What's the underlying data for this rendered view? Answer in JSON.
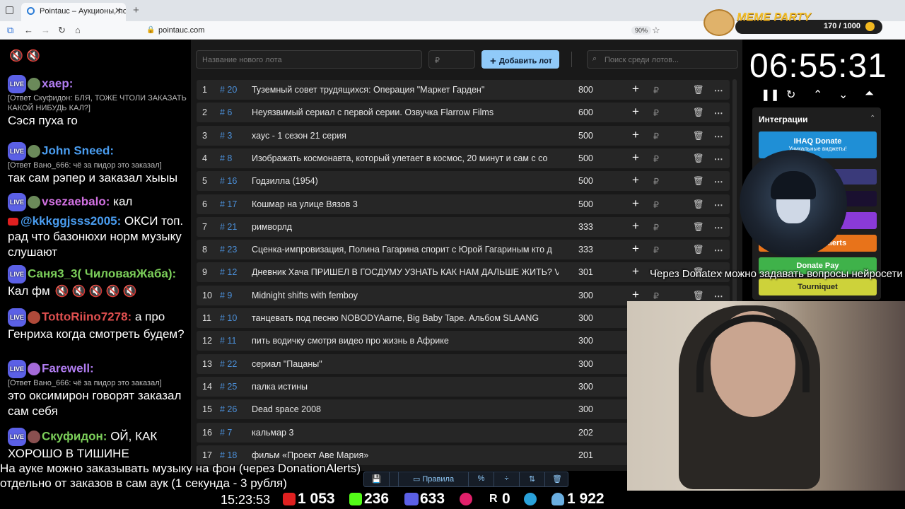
{
  "browser": {
    "tab_title": "Pointauc – Аукционы, лотереи",
    "url": "pointauc.com",
    "zoom": "90%"
  },
  "chat": [
    {
      "type": "emotes",
      "text": "🔇 🔇"
    },
    {
      "user": "хаер:",
      "user_color": "#b07cf0",
      "reply": "[Ответ Скуфидон: БЛЯ, ТОЖЕ ЧТОЛИ ЗАКАЗАТЬ КАКОЙ НИБУДЬ КАЛ?]",
      "msg": "Сэся пуха го"
    },
    {
      "user": "John Sneed:",
      "user_color": "#4a9df0",
      "reply": "[Ответ Вано_666: чё за пидор это заказал]",
      "msg": "так сам рэпер и заказал хыыы"
    },
    {
      "user": "vsezaebalo:",
      "user_color": "#d070e0",
      "msg": "кал"
    },
    {
      "user": "@kkkggjsss2005:",
      "user_color": "#4a9df0",
      "msg": "ОКСИ топ. рад что базонюхи норм музыку слушают"
    },
    {
      "user": "Саня3_3( ЧиловаяЖаба):",
      "user_color": "#7ccf5a",
      "msg": "Кал фм"
    },
    {
      "user": "TottoRiino7278:",
      "user_color": "#e05050",
      "msg": "а про Генриха когда смотреть будем?"
    },
    {
      "user": "Farewell:",
      "user_color": "#b07cf0",
      "reply": "[Ответ Вано_666: чё за пидор это заказал]",
      "msg": "это оксимирон говорят заказал сам себя"
    },
    {
      "user": "Скуфидон:",
      "user_color": "#7ccf5a",
      "msg": "ОЙ, КАК ХОРОШО В ТИШИНЕ"
    }
  ],
  "lot_input_placeholder": "Название нового лота",
  "amount_placeholder": "₽",
  "add_button": "Добавить лот",
  "search_placeholder": "Поиск среди лотов...",
  "lots": [
    {
      "n": "1",
      "id": "# 20",
      "title": "Туземный совет трудящихся: Операция \"Маркет Гарден\"",
      "amount": "800"
    },
    {
      "n": "2",
      "id": "# 6",
      "title": "Неуязвимый сериал с первой серии. Озвучка Flarrow Films",
      "amount": "600"
    },
    {
      "n": "3",
      "id": "# 3",
      "title": "хаус - 1 сезон 21 серия",
      "amount": "500"
    },
    {
      "n": "4",
      "id": "# 8",
      "title": "Изображать космонавта, который улетает в космос, 20 минут и сам с со",
      "amount": "500"
    },
    {
      "n": "5",
      "id": "# 16",
      "title": "Годзилла (1954)",
      "amount": "500"
    },
    {
      "n": "6",
      "id": "# 17",
      "title": "Кошмар на улице Вязов 3",
      "amount": "500"
    },
    {
      "n": "7",
      "id": "# 21",
      "title": "римворлд",
      "amount": "333"
    },
    {
      "n": "8",
      "id": "# 23",
      "title": "Сценка-импровизация, Полина Гагарина спорит с Юрой Гагариным кто д",
      "amount": "333"
    },
    {
      "n": "9",
      "id": "# 12",
      "title": "Дневник Хача ПРИШЕЛ В ГОСДУМУ УЗНАТЬ КАК НАМ ДАЛЬШЕ ЖИТЬ? V",
      "amount": "301"
    },
    {
      "n": "10",
      "id": "# 9",
      "title": "Midnight shifts with femboy",
      "amount": "300"
    },
    {
      "n": "11",
      "id": "# 10",
      "title": "танцевать под песню NOBODYAarne, Big Baby Tape. Альбом SLAANG",
      "amount": "300"
    },
    {
      "n": "12",
      "id": "# 11",
      "title": "пить водичку смотря видео про жизнь в Африке",
      "amount": "300"
    },
    {
      "n": "13",
      "id": "# 22",
      "title": "сериал \"Пацаны\"",
      "amount": "300"
    },
    {
      "n": "14",
      "id": "# 25",
      "title": "палка истины",
      "amount": "300"
    },
    {
      "n": "15",
      "id": "# 26",
      "title": "Dead space 2008",
      "amount": "300"
    },
    {
      "n": "16",
      "id": "# 7",
      "title": "кальмар 3",
      "amount": "202"
    },
    {
      "n": "17",
      "id": "# 18",
      "title": "фильм «Проект Аве Мария»",
      "amount": "201"
    }
  ],
  "toolbar": {
    "rules": "Правила"
  },
  "timer": "06:55:31",
  "integrations": {
    "title": "Интеграции",
    "items": [
      {
        "label": "IHAQ Donate",
        "sub": "Уникальные виджеты!",
        "color": "#1f8fd6"
      },
      {
        "label": "Alerts",
        "color": "#e8731a"
      },
      {
        "label": "Donate Pay",
        "color": "#3fb24a"
      },
      {
        "label": "Tourniquet",
        "color": "#cdd23a"
      }
    ]
  },
  "meme_party": {
    "title": "MEME PARTY",
    "count": "170 / 1000"
  },
  "overlay_right": "Через Donatex можно задавать вопросы нейросети",
  "overlay_bottom_1": "На ауке можно заказывать музыку на фон (через DonationAlerts)",
  "overlay_bottom_2": "отдельно от заказов в сам аук (1 секунда - 3 рубля)",
  "stats": {
    "time": "15:23:53",
    "youtube": "1 053",
    "kick": "236",
    "vk": "633",
    "rutube": "0",
    "telegram": "",
    "viewers": "1 922"
  }
}
